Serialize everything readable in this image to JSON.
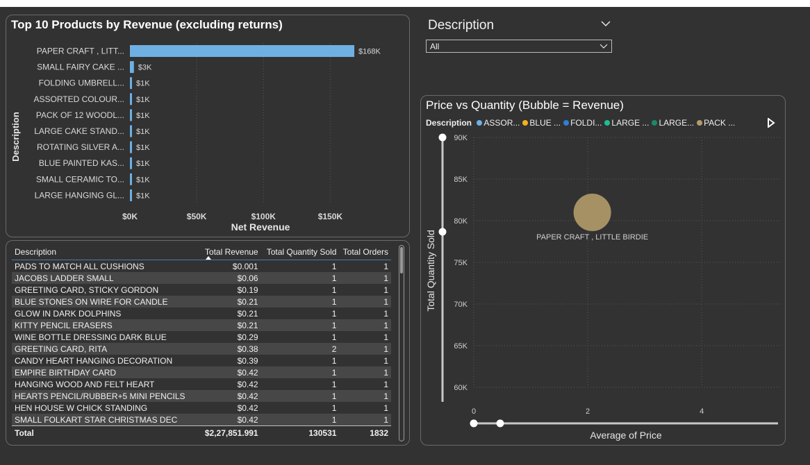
{
  "bar_chart": {
    "title": "Top 10 Products by Revenue (excluding returns)",
    "ylabel": "Description",
    "xlabel": "Net Revenue",
    "x_ticks": [
      "$0K",
      "$50K",
      "$100K",
      "$150K"
    ],
    "bar_color": "#6fb0e3"
  },
  "slicer": {
    "title": "Description",
    "value": "All"
  },
  "table": {
    "headers": [
      "Description",
      "Total Revenue",
      "Total Quantity Sold",
      "Total Orders"
    ],
    "rows": [
      [
        "PADS TO MATCH ALL CUSHIONS",
        "$0.001",
        "1",
        "1"
      ],
      [
        "JACOBS LADDER SMALL",
        "$0.06",
        "1",
        "1"
      ],
      [
        "GREETING CARD, STICKY GORDON",
        "$0.19",
        "1",
        "1"
      ],
      [
        "BLUE STONES ON WIRE FOR CANDLE",
        "$0.21",
        "1",
        "1"
      ],
      [
        "GLOW IN DARK DOLPHINS",
        "$0.21",
        "1",
        "1"
      ],
      [
        "KITTY PENCIL ERASERS",
        "$0.21",
        "1",
        "1"
      ],
      [
        "WINE BOTTLE DRESSING DARK BLUE",
        "$0.29",
        "1",
        "1"
      ],
      [
        "GREETING CARD, RITA",
        "$0.38",
        "2",
        "1"
      ],
      [
        "CANDY HEART HANGING DECORATION",
        "$0.39",
        "1",
        "1"
      ],
      [
        "EMPIRE BIRTHDAY CARD",
        "$0.42",
        "1",
        "1"
      ],
      [
        "HANGING WOOD AND FELT HEART",
        "$0.42",
        "1",
        "1"
      ],
      [
        "HEARTS PENCIL/RUBBER+5 MINI PENCILS",
        "$0.42",
        "1",
        "1"
      ],
      [
        "HEN HOUSE W CHICK STANDING",
        "$0.42",
        "1",
        "1"
      ],
      [
        "SMALL FOLKART STAR CHRISTMAS DEC",
        "$0.42",
        "1",
        "1"
      ]
    ],
    "total": [
      "Total",
      "$2,27,851.991",
      "130531",
      "1832"
    ]
  },
  "scatter": {
    "title": "Price vs Quantity (Bubble = Revenue)",
    "legend_label": "Description",
    "legend": [
      {
        "label": "ASSOR...",
        "color": "#6fb0e3"
      },
      {
        "label": "BLUE ...",
        "color": "#f2b21c"
      },
      {
        "label": "FOLDI...",
        "color": "#2f7fd8"
      },
      {
        "label": "LARGE ...",
        "color": "#1bbf95"
      },
      {
        "label": "LARGE...",
        "color": "#198a6c"
      },
      {
        "label": "PACK ...",
        "color": "#b39b6a"
      }
    ],
    "legend_next_icon": "play-right-icon",
    "ylabel": "Total Quantity Sold",
    "xlabel": "Average of Price",
    "y_ticks": [
      "90K",
      "85K",
      "80K",
      "75K",
      "70K",
      "65K",
      "60K"
    ],
    "x_ticks": [
      "0",
      "2",
      "4"
    ]
  },
  "chart_data": [
    {
      "type": "bar",
      "title": "Top 10 Products by Revenue (excluding returns)",
      "xlabel": "Net Revenue",
      "ylabel": "Description",
      "categories": [
        "PAPER CRAFT , LITT...",
        "SMALL FAIRY CAKE ...",
        "FOLDING UMBRELL...",
        "ASSORTED COLOUR...",
        "PACK OF 12 WOODL...",
        "LARGE CAKE STAND...",
        "ROTATING SILVER A...",
        "BLUE PAINTED KAS...",
        "SMALL CERAMIC TO...",
        "LARGE HANGING GL..."
      ],
      "values": [
        168000,
        3000,
        1000,
        1000,
        1000,
        1000,
        1000,
        1000,
        1000,
        1000
      ],
      "data_labels": [
        "$168K",
        "$3K",
        "$1K",
        "$1K",
        "$1K",
        "$1K",
        "$1K",
        "$1K",
        "$1K",
        "$1K"
      ],
      "xlim": [
        0,
        180000
      ],
      "grid": true
    },
    {
      "type": "scatter",
      "title": "Price vs Quantity (Bubble = Revenue)",
      "xlabel": "Average of Price",
      "ylabel": "Total Quantity Sold",
      "xlim": [
        0,
        5.4
      ],
      "ylim": [
        58000,
        90000
      ],
      "points": [
        {
          "label": "PAPER CRAFT , LITTLE BIRDIE",
          "x": 2.08,
          "y": 80995,
          "color": "#b39b6a"
        }
      ],
      "grid": true
    }
  ]
}
